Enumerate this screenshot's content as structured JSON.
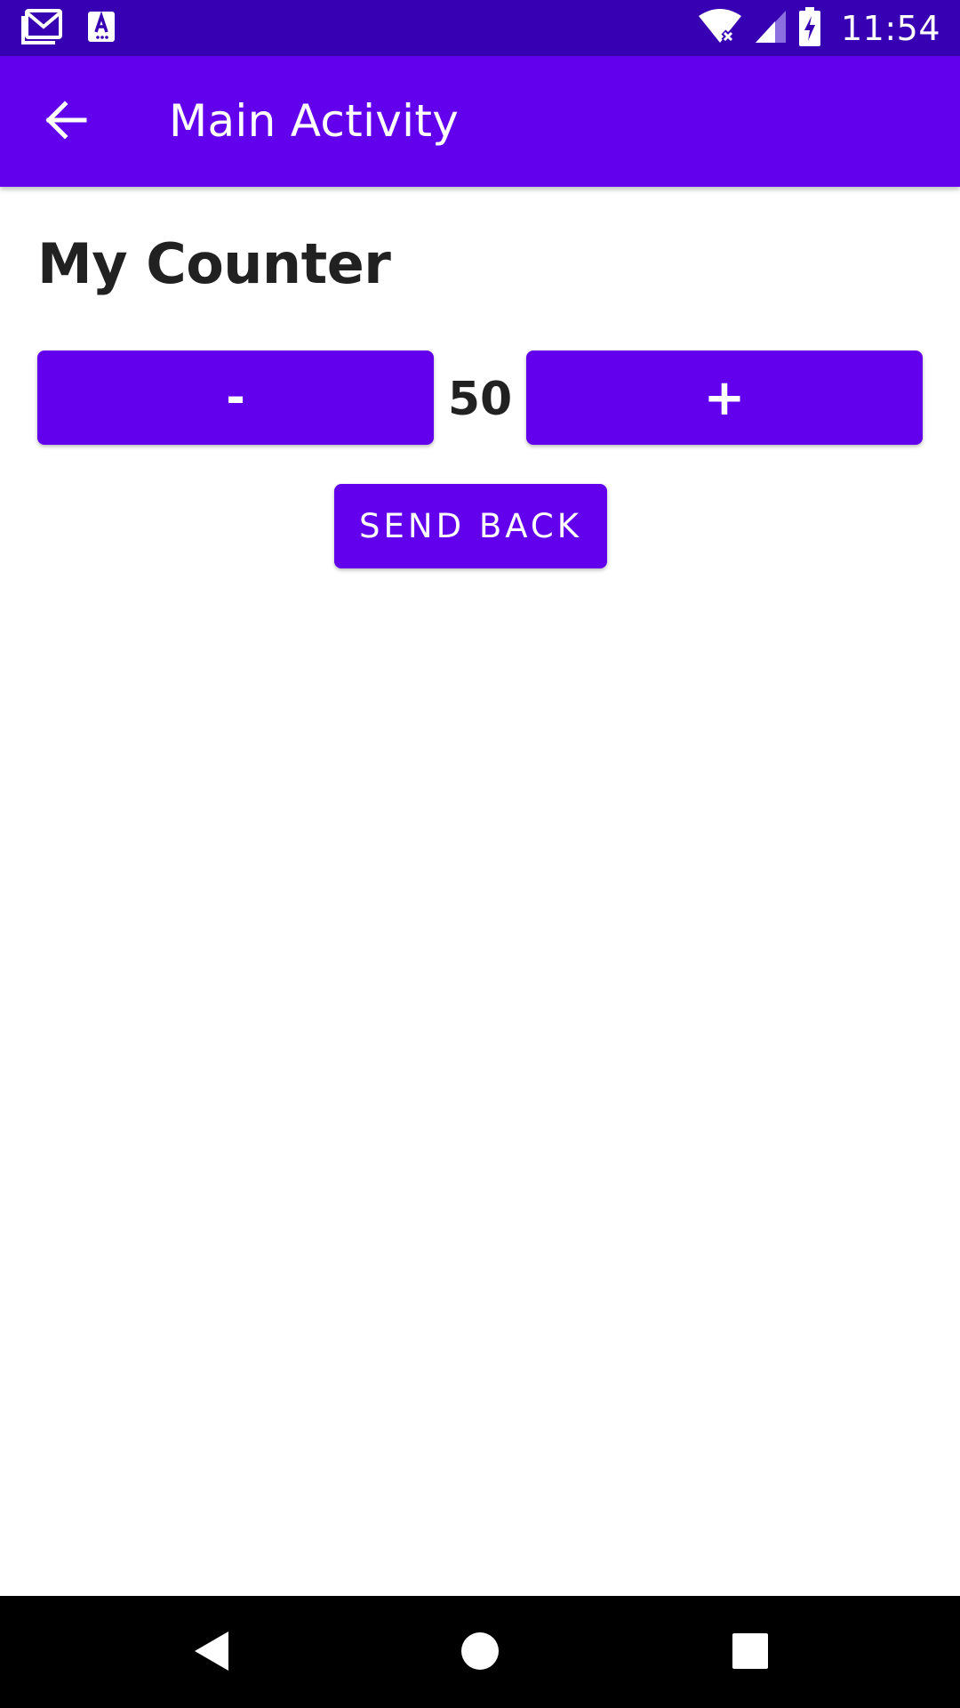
{
  "status_bar": {
    "time": "11:54",
    "icons": [
      "gmail-icon",
      "accessibility-icon",
      "wifi-icon",
      "cell-signal-icon",
      "battery-charging-icon"
    ]
  },
  "app_bar": {
    "back_icon": "arrow-back-icon",
    "title": "Main Activity"
  },
  "main": {
    "heading": "My Counter",
    "counter": {
      "decrement_label": "-",
      "value": "50",
      "increment_label": "+"
    },
    "send_back_label": "SEND BACK"
  },
  "nav_bar": {
    "icons": [
      "nav-back-icon",
      "nav-home-icon",
      "nav-recents-icon"
    ]
  },
  "colors": {
    "status_bar": "#3700B3",
    "primary": "#6200EE",
    "text_primary": "#212121",
    "nav_bar": "#000000"
  }
}
